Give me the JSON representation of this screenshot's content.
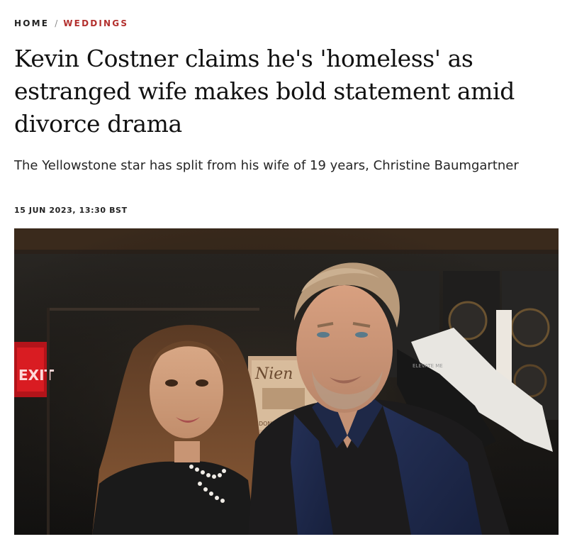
{
  "breadcrumb": {
    "home": "HOME",
    "separator": "/",
    "section": "WEDDINGS"
  },
  "article": {
    "headline": "Kevin Costner claims he's 'homeless' as estranged wife makes bold statement amid divorce drama",
    "standfirst": "The Yellowstone star has split from his wife of 19 years, Christine Baumgartner",
    "dateline": "15 JUN 2023, 13:30 BST"
  },
  "photo": {
    "exit_sign": "EXIT",
    "wine_label": "Nien",
    "wine_sub": "DONNAY",
    "case_label": "ELEVATE ME",
    "description_icon": "photo-of-kevin-costner-and-christine-baumgartner"
  },
  "colors": {
    "accent": "#b3302e",
    "text": "#111111"
  }
}
